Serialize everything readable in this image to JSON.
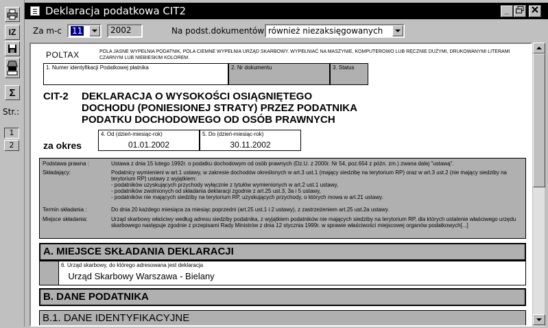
{
  "window": {
    "title": "Deklaracja podatkowa CIT2",
    "min_label": "_",
    "restore_label": "🗗",
    "close_label": "✕"
  },
  "toolbar": {
    "buttons": [
      {
        "icon": "printer-icon"
      },
      {
        "icon": "iz-icon",
        "label": "IZ"
      },
      {
        "icon": "save-icon"
      },
      {
        "icon": "stamp-icon"
      },
      {
        "icon": "sum-icon",
        "label": "Σ"
      }
    ],
    "pages_label": "Str.:",
    "pages": [
      "1",
      "2"
    ]
  },
  "filter": {
    "month_label": "Za m-c",
    "month_value": "11",
    "year_value": "2002",
    "docs_label": "Na podst.dokumentów",
    "docs_value": "również niezaksięgowanych"
  },
  "document": {
    "poltax": "POLTAX",
    "instructions": "POLA JASNE WYPEŁNIA PODATNIK, POLA CIEMNE WYPEŁNIA URZĄD SKARBOWY. WYPEŁNIAĆ NA MASZYNIE, KOMPUTEROWO LUB RĘCZNIE DUŻYMI, DRUKOWANYMI LITERAMI CZARNYM LUB NIEBIESKIM KOLOREM.",
    "field1_label": "1. Numer identyfikacji Podatkowej płatnika",
    "field2_label": "2. Nr dokumentu",
    "field3_label": "3. Status",
    "form_id": "CIT-2",
    "form_title_1": "DEKLARACJA O WYSOKOŚCI OSIĄGNIĘTEGO",
    "form_title_2": "DOCHODU (PONIESIONEJ STRATY) PRZEZ PODATNIKA",
    "form_title_3": "PODATKU DOCHODOWEGO OD OSÓB PRAWNYCH",
    "za_okres": "za okres",
    "field4_label": "4. Od (dzień-miesiąc-rok)",
    "field4_value": "01.01.2002",
    "field5_label": "5. Do (dzień-miesiąc-rok)",
    "field5_value": "30.11.2002",
    "info": [
      {
        "key": "Podstawa prawna :",
        "value": "Ustawa z dnia 15 lutego 1992r. o podatku dochodowym od osób prawnych (Dz.U. z 2000r. Nr 54, poz.654 z późn. zm.) zwana dalej \"ustawą\"."
      },
      {
        "key": "Składający:",
        "value": "Podatnicy wymienieni w art.1 ustawy, w zakresie dochodów określonych w art.3 ust.1 (mający siedzibę na terytorium RP) oraz w art.3 ust.2 (nie mający siedziby na terytorium RP) ustawy z wyjątkiem:\n- podatników uzyskujących przychody wyłącznie z tytułów wymienionych w art.2 ust.1 ustawy,\n- podatników zwolnionych od składania deklaracji zgodnie z art.25 ust.3, 3a i 5 ustawy,\n- podatników nie mających siedziby na terytorium RP, uzyskujących przychody, o których mowa w art.21 ustawy."
      },
      {
        "key": "Termin składania :",
        "value": "Do dnia 20 każdego miesiąca za miesiąc poprzedni (art.25 ust.1 i 2 ustawy), z zastrzeżeniem art.25 ust.2a ustawy."
      },
      {
        "key": "Miejsce składania:",
        "value": "Urząd skarbowy właściwy według adresu siedziby podatnika, z wyjątkiem podatników nie mających siedziby na terytorium RP, dla których ustalenie właściwego urzędu skarbowego następuje zgodnie z przepisami Rady Ministrów z dnia 12 stycznia 1999r. w sprawie właściwości miejscowej organów podatkowych[...]"
      }
    ],
    "section_a": "A. MIEJSCE SKŁADANIA DEKLARACJI",
    "field6_label": "6. Urząd skarbowy, do którego adresowana jest deklaracja",
    "field6_value": "Urząd Skarbowy Warszawa - Bielany",
    "section_b": "B. DANE PODATNIKA",
    "section_b1": "B.1. DANE IDENTYFIKACYJNE"
  }
}
